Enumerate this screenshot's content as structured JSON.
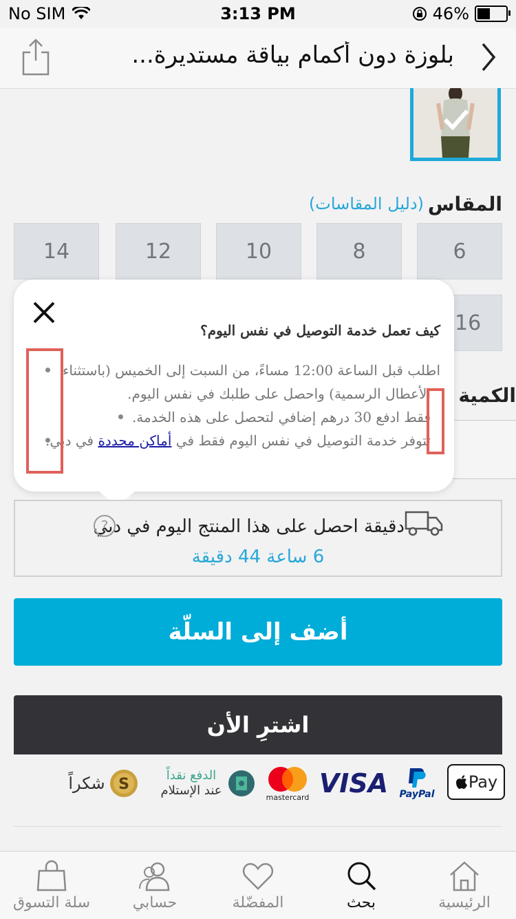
{
  "status": {
    "carrier": "No SIM",
    "time": "3:13 PM",
    "battery": "46%"
  },
  "header": {
    "title": "بلوزة دون أكمام بياقة مستديرة..."
  },
  "size": {
    "label": "المقاس",
    "guide": "(دليل المقاسات)",
    "options_row1": [
      "6",
      "8",
      "10",
      "12",
      "14"
    ],
    "options_row2_partial": "16"
  },
  "quantity": {
    "label": "الكمية"
  },
  "popup": {
    "title": "كيف تعمل خدمة التوصيل في نفس اليوم؟",
    "line1": "اطلب قبل الساعة 12:00 مساءً، من السبت إلى الخميس (باستثناء",
    "line2": "الأعطال الرسمية) واحصل على طلبك في نفس اليوم.",
    "line3": "فقط ادفع 30 درهم إضافي لتحصل على هذه الخدمة.",
    "line4_pre": "تتوفر خدمة التوصيل في نفس اليوم فقط في",
    "line4_link": "أماكن محددة",
    "line4_post": "في دبي."
  },
  "delivery": {
    "text": "دقيقة احصل على هذا المنتج اليوم في دبي",
    "timer": "6 ساعة 44 دقيقة",
    "help": "?"
  },
  "buttons": {
    "add_to_cart": "أضف إلى السلّة",
    "buy_now": "اشترِ الأن"
  },
  "payments": {
    "apple_pay": "Pay",
    "paypal": "PayPal",
    "visa": "VISA",
    "mastercard": "mastercard",
    "cod_line1": "الدفع نقداً",
    "cod_line2": "عند الإستلام",
    "shukran": "شكراً"
  },
  "tabs": [
    {
      "label": "الرئيسية",
      "icon": "home-icon"
    },
    {
      "label": "بحث",
      "icon": "search-icon"
    },
    {
      "label": "المفضّلة",
      "icon": "heart-icon"
    },
    {
      "label": "حسابي",
      "icon": "account-icon"
    },
    {
      "label": "سلة التسوق",
      "icon": "shopping-bag-icon"
    }
  ],
  "colors": {
    "accent": "#00acd8",
    "dark_button": "#333337",
    "highlight": "#e0615a"
  }
}
